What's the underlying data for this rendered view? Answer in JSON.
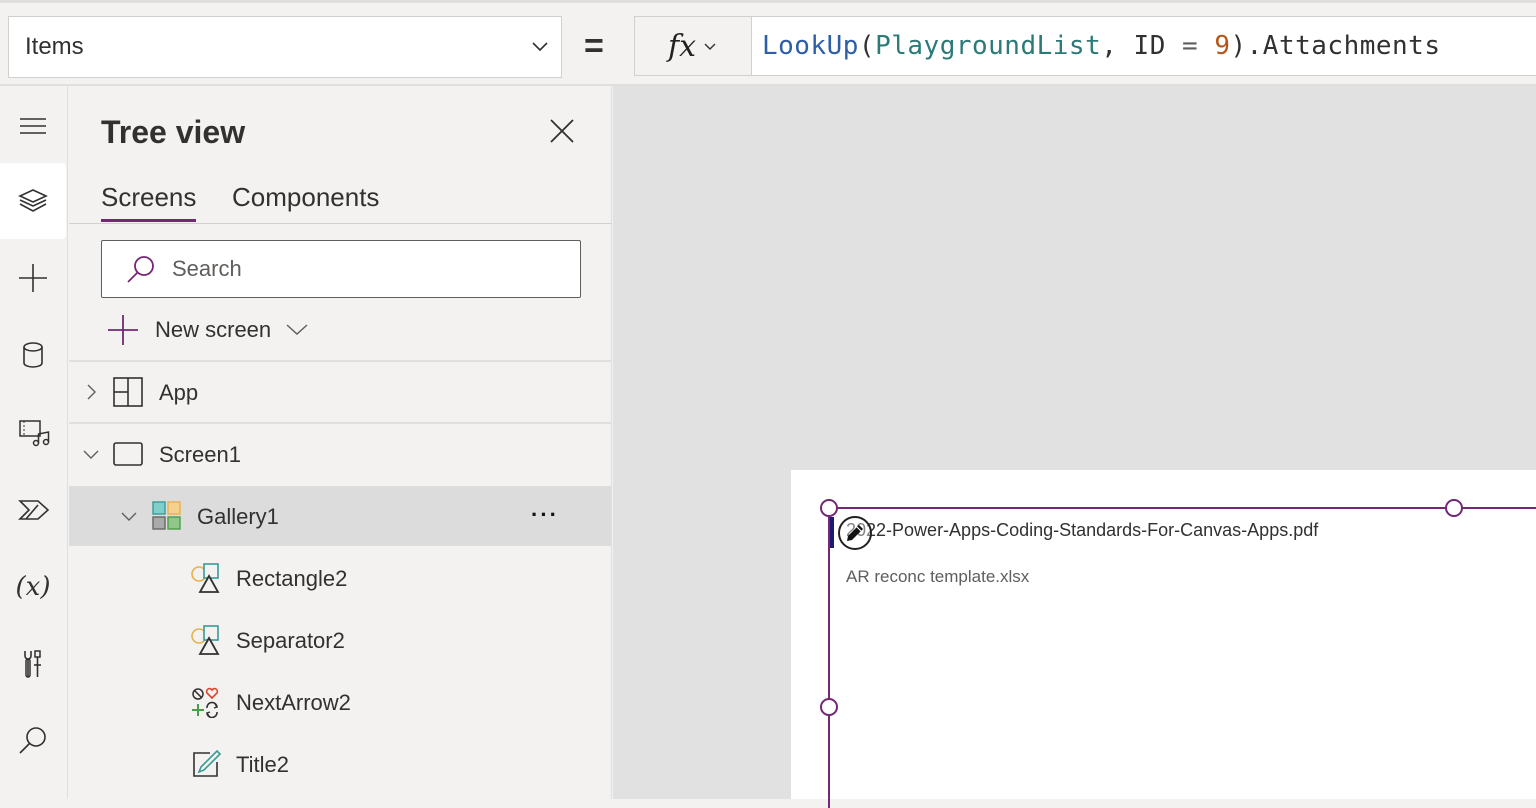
{
  "formula_bar": {
    "property": "Items",
    "equals": "=",
    "fx_label": "fx",
    "formula_tokens": [
      {
        "type": "fn",
        "text": "LookUp"
      },
      {
        "type": "punc",
        "text": "("
      },
      {
        "type": "id",
        "text": "PlaygroundList"
      },
      {
        "type": "punc",
        "text": ", "
      },
      {
        "type": "prop",
        "text": "ID"
      },
      {
        "type": "op",
        "text": " = "
      },
      {
        "type": "num",
        "text": "9"
      },
      {
        "type": "punc",
        "text": ")."
      },
      {
        "type": "prop",
        "text": "Attachments"
      }
    ]
  },
  "rail": {
    "items": [
      {
        "name": "menu",
        "icon": "hamburger-icon"
      },
      {
        "name": "tree-view",
        "icon": "layers-icon",
        "active": true
      },
      {
        "name": "insert",
        "icon": "plus-icon"
      },
      {
        "name": "data",
        "icon": "database-icon"
      },
      {
        "name": "media",
        "icon": "media-icon"
      },
      {
        "name": "power-automate",
        "icon": "power-automate-icon"
      },
      {
        "name": "variables",
        "icon": "variables-icon",
        "text": "(x)"
      },
      {
        "name": "advanced-tools",
        "icon": "tools-icon"
      },
      {
        "name": "search",
        "icon": "search-icon"
      }
    ]
  },
  "tree": {
    "title": "Tree view",
    "tabs": [
      {
        "label": "Screens",
        "active": true
      },
      {
        "label": "Components",
        "active": false
      }
    ],
    "search_placeholder": "Search",
    "new_screen_label": "New screen",
    "nodes": [
      {
        "label": "App",
        "type": "app",
        "expanded": false
      },
      {
        "label": "Screen1",
        "type": "screen",
        "expanded": true
      },
      {
        "label": "Gallery1",
        "type": "gallery",
        "expanded": true,
        "selected": true,
        "more": "···"
      },
      {
        "label": "Rectangle2",
        "type": "shape"
      },
      {
        "label": "Separator2",
        "type": "shape"
      },
      {
        "label": "NextArrow2",
        "type": "icon"
      },
      {
        "label": "Title2",
        "type": "label"
      }
    ]
  },
  "canvas": {
    "gallery_items": [
      {
        "title": "2022-Power-Apps-Coding-Standards-For-Canvas-Apps.pdf"
      },
      {
        "title": "AR reconc template.xlsx"
      }
    ],
    "accent_color": "#742774"
  },
  "colors": {
    "accent": "#742774",
    "panel_bg": "#f3f2f1",
    "canvas_bg": "#e1e1e1",
    "selected_row": "#dcdcdc"
  }
}
